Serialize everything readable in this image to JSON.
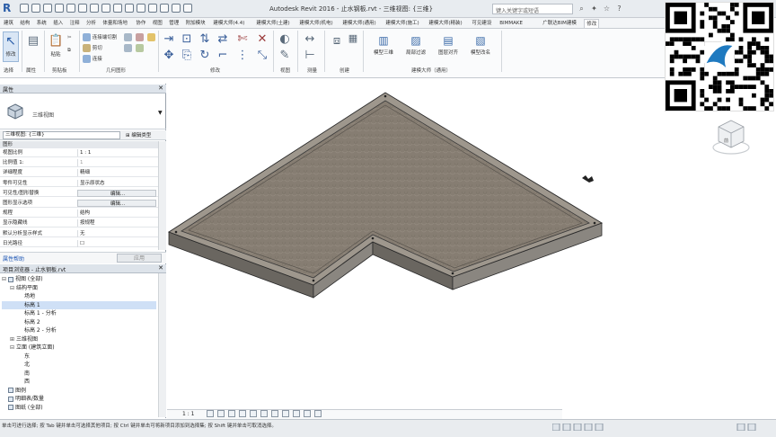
{
  "window": {
    "title": "Autodesk Revit 2016 -  止水钢板.rvt - 三维视图: {三维}",
    "search_placeholder": "键入关键字或短语"
  },
  "ribbon": {
    "tabs": [
      "建筑",
      "结构",
      "系统",
      "插入",
      "注释",
      "分析",
      "体量和场地",
      "协作",
      "视图",
      "管理",
      "附加模块",
      "建模大师(4.4)",
      "建模大师(土建)",
      "建模大师(机电)",
      "建模大师(通用)",
      "建模大师(施工)",
      "建模大师(精装)",
      "可见建设",
      "BIMMAKE",
      "广联达BIM建模",
      "修改"
    ],
    "active_tab": "修改",
    "panels": [
      "选择",
      "属性",
      "剪贴板",
      "几何图形",
      "修改",
      "视图",
      "测量",
      "创建",
      "建模大师（通用）"
    ],
    "modify_label": "修改",
    "clipboard": [
      "粘贴",
      "剪切",
      "复制"
    ],
    "geometry": [
      "连接端切割",
      "剪切",
      "连接"
    ],
    "create_label": "创建",
    "modeler_buttons": [
      "模型三维",
      "局部过滤",
      "图层对齐",
      "模型改名"
    ]
  },
  "properties": {
    "header": "属性",
    "type_name": "三维视图",
    "filter": "三维视图: {三维}",
    "edit_type": "编辑类型",
    "section": "图形",
    "rows": [
      {
        "k": "视图比例",
        "v": "1 : 1",
        "kind": "plain"
      },
      {
        "k": "比例值 1:",
        "v": "1",
        "kind": "dim"
      },
      {
        "k": "详细程度",
        "v": "精细",
        "kind": "plain"
      },
      {
        "k": "零件可见性",
        "v": "显示原状态",
        "kind": "plain"
      },
      {
        "k": "可见性/图形替换",
        "v": "编辑...",
        "kind": "btn"
      },
      {
        "k": "图形显示选项",
        "v": "编辑...",
        "kind": "btn"
      },
      {
        "k": "规程",
        "v": "结构",
        "kind": "plain"
      },
      {
        "k": "显示隐藏线",
        "v": "按规程",
        "kind": "plain"
      },
      {
        "k": "默认分析显示样式",
        "v": "无",
        "kind": "plain"
      },
      {
        "k": "日光路径",
        "v": "☐",
        "kind": "plain"
      }
    ],
    "help_link": "属性帮助",
    "apply": "应用"
  },
  "browser": {
    "header": "项目浏览器 - 止水钢板.rvt",
    "tree": [
      {
        "text": "视图 (全部)",
        "depth": 0,
        "toggle": "⊟",
        "icon": true
      },
      {
        "text": "结构平面",
        "depth": 1,
        "toggle": "⊟",
        "icon": false
      },
      {
        "text": "场地",
        "depth": 2,
        "toggle": "",
        "icon": false
      },
      {
        "text": "标高 1",
        "depth": 2,
        "toggle": "",
        "icon": false,
        "selected": true
      },
      {
        "text": "标高 1 - 分析",
        "depth": 2,
        "toggle": "",
        "icon": false
      },
      {
        "text": "标高 2",
        "depth": 2,
        "toggle": "",
        "icon": false
      },
      {
        "text": "标高 2 - 分析",
        "depth": 2,
        "toggle": "",
        "icon": false
      },
      {
        "text": "三维视图",
        "depth": 1,
        "toggle": "⊞",
        "icon": false
      },
      {
        "text": "立面 (建筑立面)",
        "depth": 1,
        "toggle": "⊟",
        "icon": false
      },
      {
        "text": "东",
        "depth": 2,
        "toggle": "",
        "icon": false
      },
      {
        "text": "北",
        "depth": 2,
        "toggle": "",
        "icon": false
      },
      {
        "text": "南",
        "depth": 2,
        "toggle": "",
        "icon": false
      },
      {
        "text": "西",
        "depth": 2,
        "toggle": "",
        "icon": false
      },
      {
        "text": "图例",
        "depth": 0,
        "toggle": "",
        "icon": true
      },
      {
        "text": "明细表/数量",
        "depth": 0,
        "toggle": "",
        "icon": true
      },
      {
        "text": "图纸 (全部)",
        "depth": 0,
        "toggle": "",
        "icon": true
      }
    ]
  },
  "view": {
    "scale": "1 : 1",
    "cube_label": "前"
  },
  "status": {
    "text": "单击可进行选择; 按 Tab 键并单击可选择其他项目; 按 Ctrl 键并单击可将新项目添加到选择集; 按 Shift 键并单击可取消选择。"
  }
}
